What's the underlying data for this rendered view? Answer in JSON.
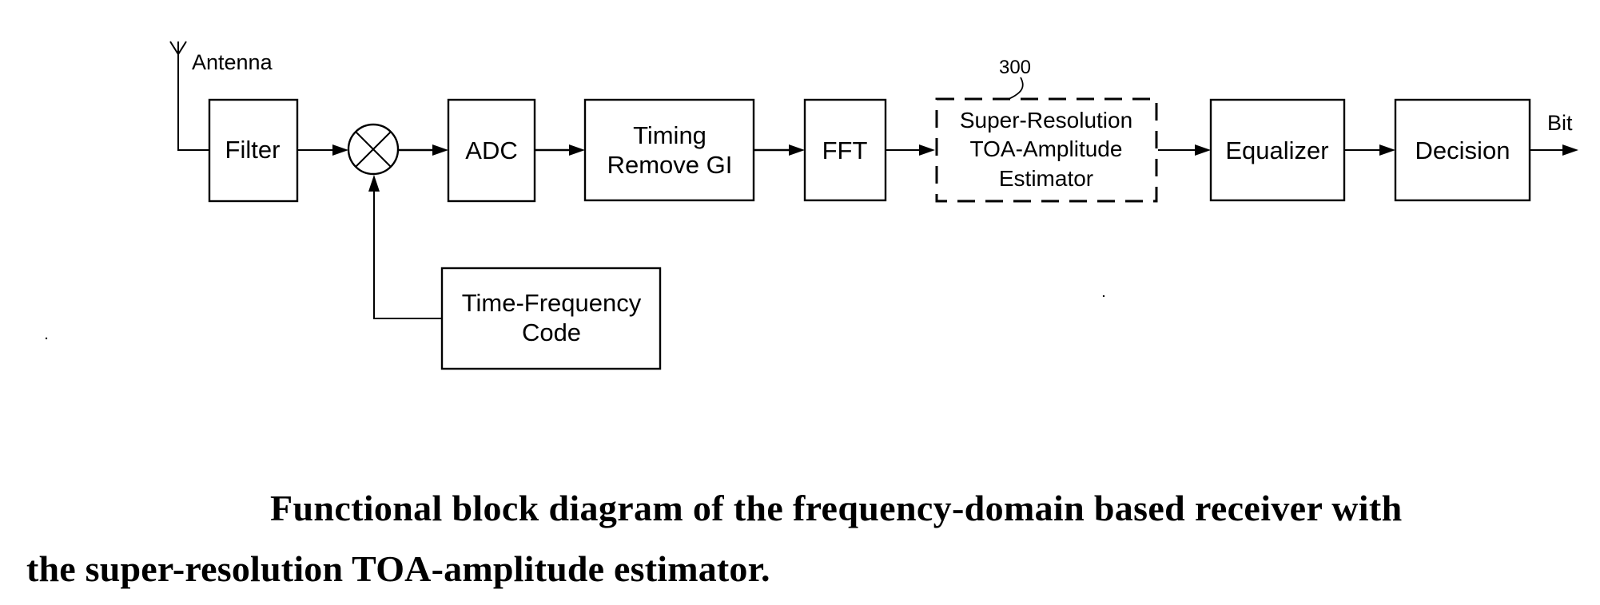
{
  "diagram": {
    "type": "block-diagram",
    "title": "Functional block diagram of the frequency-domain based receiver with the super-resolution TOA-amplitude estimator.",
    "input_label": "Antenna",
    "output_label": "Bit",
    "reference_numeral": "300",
    "blocks": {
      "filter": {
        "lines": [
          "Filter"
        ]
      },
      "mixer": {
        "symbol": "multiplier-icon"
      },
      "adc": {
        "lines": [
          "ADC"
        ]
      },
      "timing": {
        "lines": [
          "Timing",
          "Remove GI"
        ]
      },
      "fft": {
        "lines": [
          "FFT"
        ]
      },
      "estimator": {
        "lines": [
          "Super-Resolution",
          "TOA-Amplitude",
          "Estimator"
        ],
        "style": "dashed"
      },
      "equalizer": {
        "lines": [
          "Equalizer"
        ]
      },
      "decision": {
        "lines": [
          "Decision"
        ]
      },
      "tfcode": {
        "lines": [
          "Time-Frequency",
          "Code"
        ]
      }
    },
    "signal_flow": [
      "Antenna -> Filter",
      "Filter -> Mixer",
      "Time-Frequency Code -> Mixer",
      "Mixer -> ADC",
      "ADC -> Timing Remove GI",
      "Timing Remove GI -> FFT",
      "FFT -> Super-Resolution TOA-Amplitude Estimator",
      "Super-Resolution TOA-Amplitude Estimator -> Equalizer",
      "Equalizer -> Decision",
      "Decision -> Bit"
    ]
  },
  "caption": {
    "line1": "Functional block diagram of the frequency-domain based receiver with",
    "line2": "the super-resolution TOA-amplitude estimator."
  }
}
